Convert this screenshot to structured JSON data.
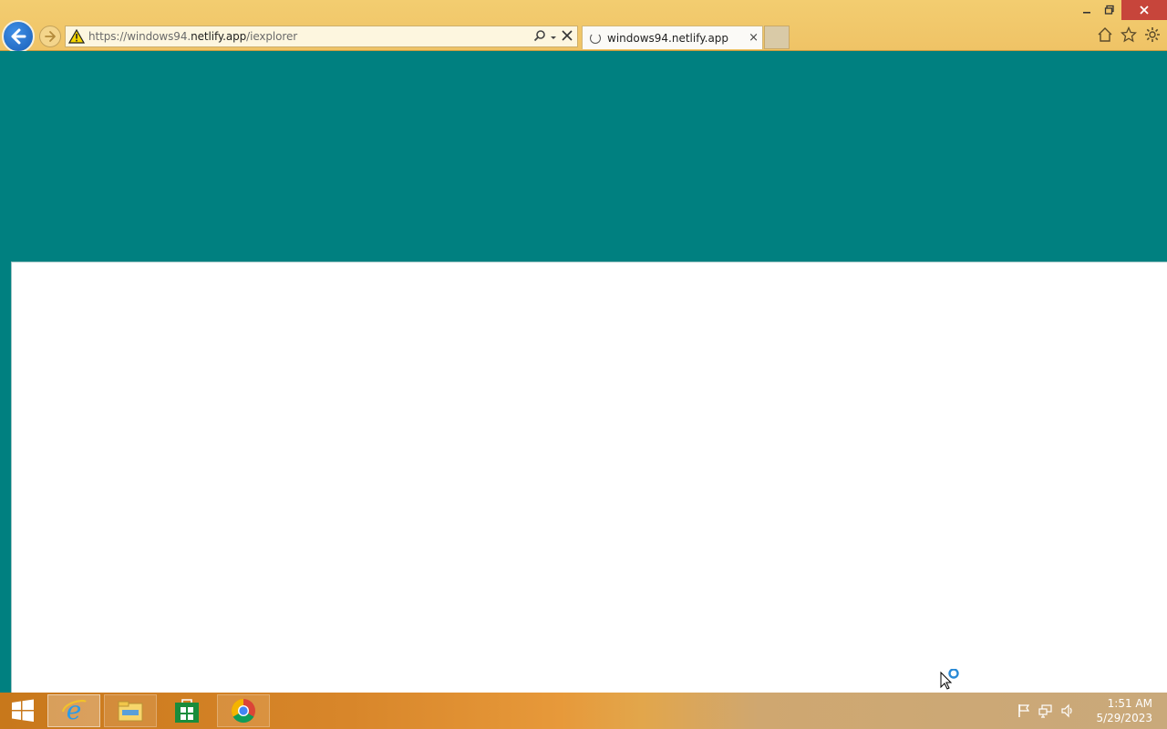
{
  "browser": {
    "address_scheme_host_pre": "https://windows94.",
    "address_host_main": "netlify.app",
    "address_path": "/iexplorer",
    "tab_title": "windows94.netlify.app",
    "tab_close_glyph": "×"
  },
  "taskbar": {
    "pinned": [
      "internet-explorer",
      "file-explorer",
      "store",
      "chrome"
    ],
    "clock_time": "1:51 AM",
    "clock_date": "5/29/2023"
  },
  "colors": {
    "desktop_teal": "#008080",
    "chrome_bg": "#efc366",
    "close_red": "#c7453b"
  }
}
